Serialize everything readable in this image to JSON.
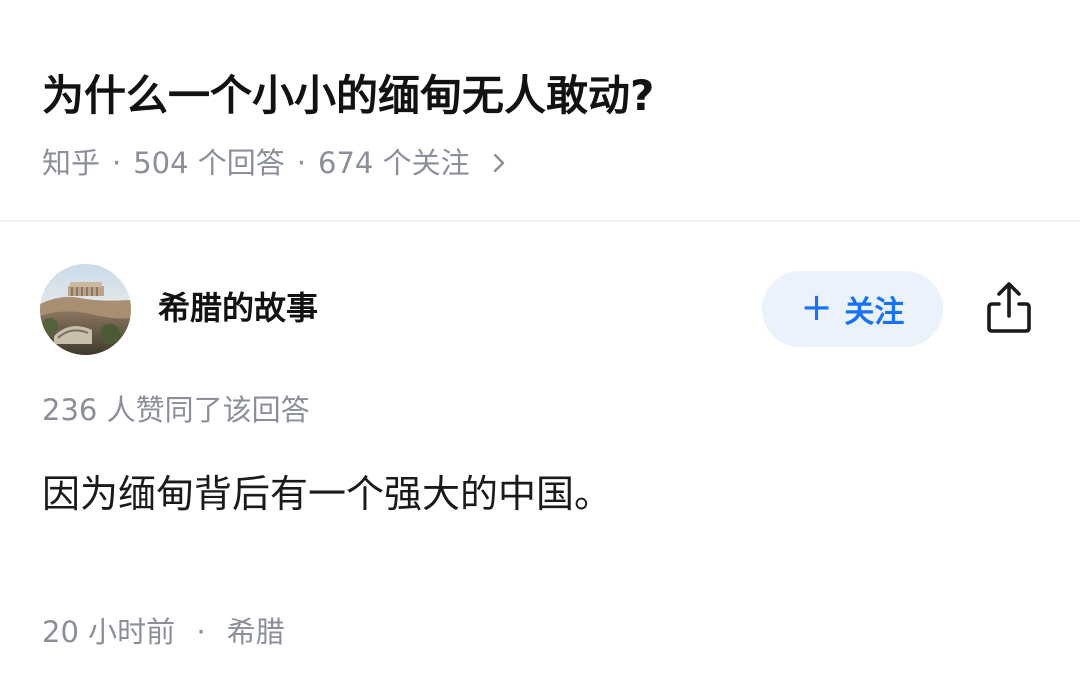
{
  "question": {
    "title": "为什么一个小小的缅甸无人敢动?",
    "source": "知乎",
    "separator": "·",
    "answers_count": "504 个回答",
    "followers_count": "674 个关注"
  },
  "answer": {
    "author_name": "希腊的故事",
    "follow_label": "关注",
    "follow_plus": "+",
    "votes_text": "236 人赞同了该回答",
    "content": "因为缅甸背后有一个强大的中国。",
    "time": "20 小时前",
    "location": "希腊"
  },
  "icons": {
    "meta_chevron": "chevron-right-icon",
    "share": "share-icon"
  },
  "colors": {
    "accent": "#1772f6",
    "follow_bg": "#ebf2fc",
    "meta_text": "#8a8f99",
    "title_text": "#121212"
  }
}
